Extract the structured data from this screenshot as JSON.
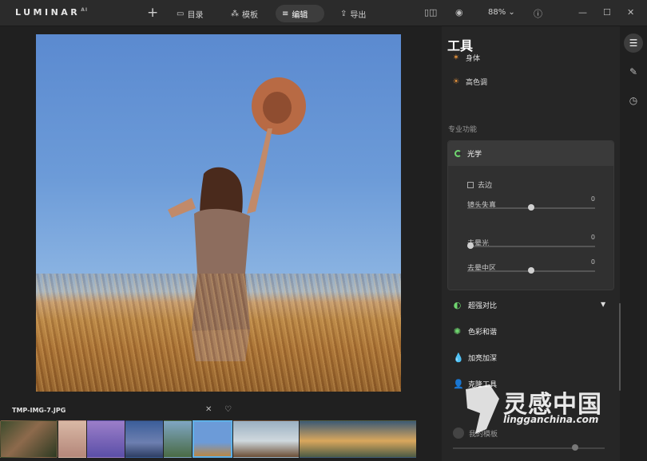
{
  "app": {
    "logo": "LUMINAR",
    "logo_sup": "AI"
  },
  "nav": {
    "catalog": "目录",
    "templates": "模板",
    "edit": "编辑",
    "export": "导出"
  },
  "toolbar": {
    "zoom": "88%"
  },
  "filmstrip": {
    "filename": "TMP-IMG-7.JPG"
  },
  "panel": {
    "title": "工具",
    "tool_clipped": "身体",
    "tool_highkey": "高色调",
    "section_pro": "专业功能",
    "optics": {
      "title": "光学",
      "defringe": "去边",
      "sliders": [
        {
          "label": "镜头失真",
          "value": "0",
          "level": 0.5
        },
        {
          "label": "去晕光",
          "value": "0",
          "level": 0.0
        },
        {
          "label": "去晕中区",
          "value": "0",
          "level": 0.5
        }
      ]
    },
    "items": [
      "超强对比",
      "色彩和谐",
      "加亮加深",
      "克隆工具"
    ],
    "bottom_label": "我的模板"
  },
  "watermark": {
    "cn": "灵感中国",
    "en": "lingganchina.com"
  },
  "colors": {
    "accent_green": "#6fd66f",
    "selection_blue": "#5fb1e8"
  }
}
